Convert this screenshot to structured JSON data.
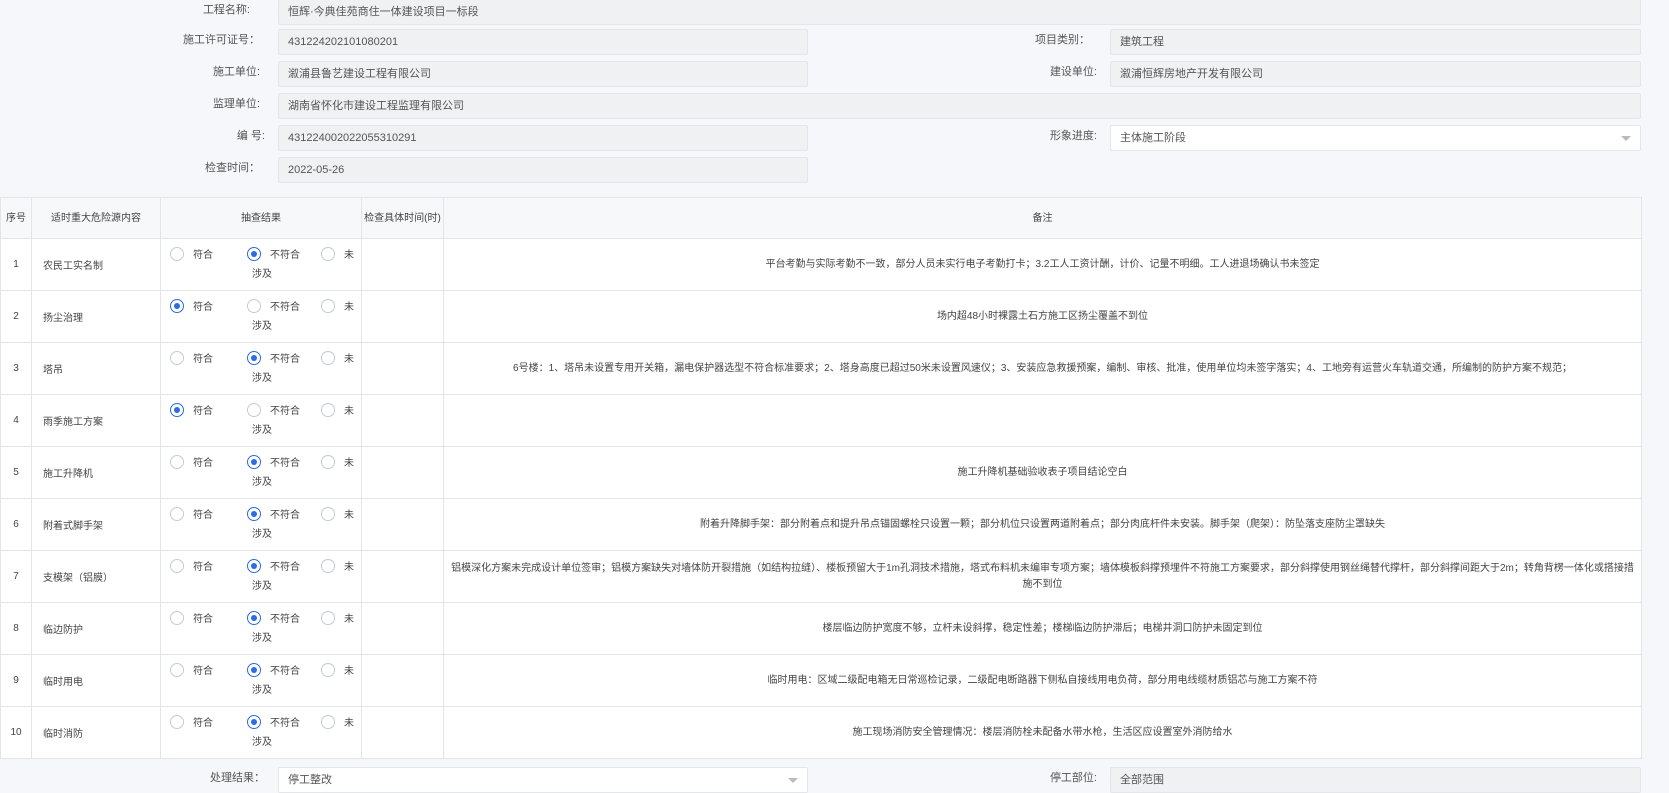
{
  "form": {
    "project_name_label": "工程名称:",
    "project_name": "恒辉·今典佳苑商住一体建设项目一标段",
    "permit_label": "施工许可证号：",
    "permit_no": "431224202101080201",
    "category_label": "项目类别：",
    "category": "建筑工程",
    "builder_label": "施工单位:",
    "builder": "溆浦县鲁艺建设工程有限公司",
    "owner_label": "建设单位:",
    "owner": "溆浦恒辉房地产开发有限公司",
    "supervisor_label": "监理单位:",
    "supervisor": "湖南省怀化市建设工程监理有限公司",
    "number_label": "编 号:",
    "number": "431224002022055310291",
    "progress_label": "形象进度:",
    "progress": "主体施工阶段",
    "check_time_label": "检查时间：",
    "check_time": "2022-05-26"
  },
  "table": {
    "headers": {
      "no": "序号",
      "item": "适时重大危险源内容",
      "result": "抽查结果",
      "time": "检查具体时间(时)",
      "remark": "备注"
    },
    "option_labels": {
      "ok": "符合",
      "fail": "不符合",
      "na_1": "未",
      "na_2": "涉及"
    },
    "rows": [
      {
        "no": "1",
        "item": "农民工实名制",
        "selected": "fail",
        "time": "",
        "remark": "平台考勤与实际考勤不一致，部分人员未实行电子考勤打卡；3.2工人工资计酬，计价、记量不明细。工人进退场确认书未签定"
      },
      {
        "no": "2",
        "item": "扬尘治理",
        "selected": "ok",
        "time": "",
        "remark": "场内超48小时裸露土石方施工区扬尘覆盖不到位"
      },
      {
        "no": "3",
        "item": "塔吊",
        "selected": "fail",
        "time": "",
        "remark": "6号楼：1、塔吊未设置专用开关箱，漏电保护器选型不符合标准要求；2、塔身高度已超过50米未设置风速仪；3、安装应急救援预案，编制、审核、批准，使用单位均未签字落实；4、工地旁有运营火车轨道交通，所编制的防护方案不规范；"
      },
      {
        "no": "4",
        "item": "雨季施工方案",
        "selected": "ok",
        "time": "",
        "remark": ""
      },
      {
        "no": "5",
        "item": "施工升降机",
        "selected": "fail",
        "time": "",
        "remark": "施工升降机基础验收表子项目结论空白"
      },
      {
        "no": "6",
        "item": "附着式脚手架",
        "selected": "fail",
        "time": "",
        "remark": "附着升降脚手架：部分附着点和提升吊点锚固螺栓只设置一颗；部分机位只设置两道附着点；部分肉底杆件未安装。脚手架（爬架）：防坠落支座防尘罩缺失"
      },
      {
        "no": "7",
        "item": "支模架（铝膜）",
        "selected": "fail",
        "time": "",
        "remark": "铝模深化方案未完成设计单位签审；铝模方案缺失对墙体防开裂措施（如结构拉缝）、楼板预留大于1m孔洞技术措施，塔式布料机未编审专项方案；墙体模板斜撑预埋件不符施工方案要求，部分斜撑使用钢丝绳替代撑杆，部分斜撑间距大于2m；转角背楞一体化或搭接措施不到位"
      },
      {
        "no": "8",
        "item": "临边防护",
        "selected": "fail",
        "time": "",
        "remark": "楼层临边防护宽度不够，立杆未设斜撑，稳定性差；楼梯临边防护滞后；电梯井洞口防护未固定到位"
      },
      {
        "no": "9",
        "item": "临时用电",
        "selected": "fail",
        "time": "",
        "remark": "临时用电：区域二级配电箱无日常巡检记录，二级配电断路器下侧私自接线用电负荷，部分用电线缆材质铝芯与施工方案不符"
      },
      {
        "no": "10",
        "item": "临时消防",
        "selected": "fail",
        "time": "",
        "remark": "施工现场消防安全管理情况：楼层消防栓未配备水带水枪，生活区应设置室外消防给水"
      }
    ]
  },
  "footer": {
    "result_label": "处理结果：",
    "result": "停工整改",
    "stop_label": "停工部位:",
    "stop_part": "全部范围"
  }
}
